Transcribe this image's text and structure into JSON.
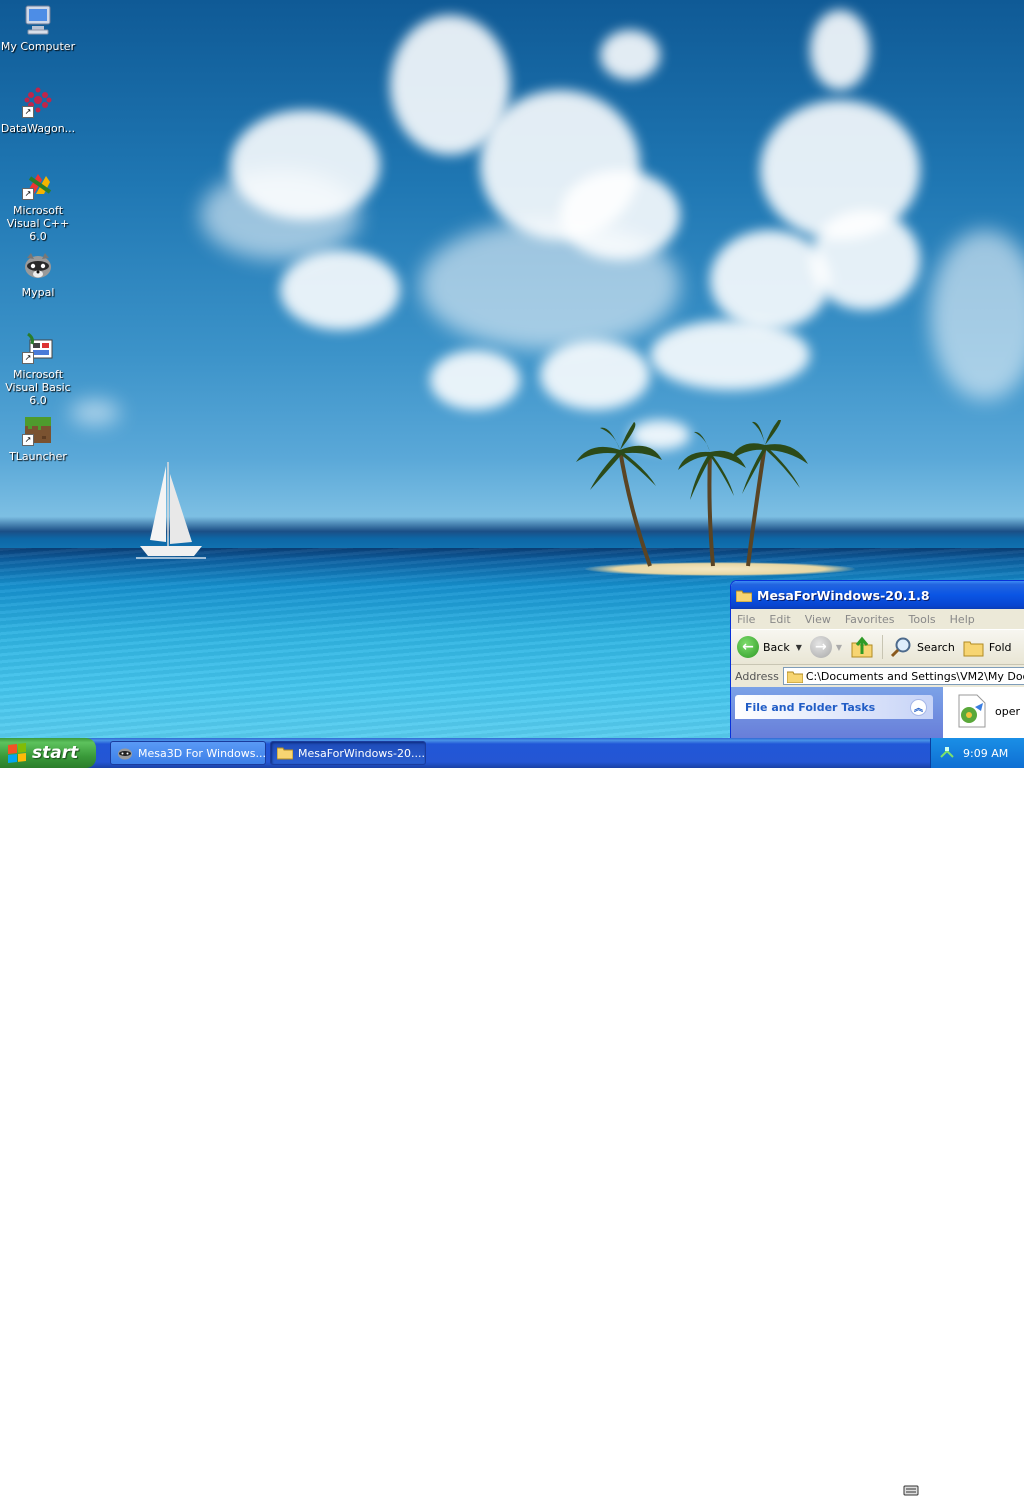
{
  "desktop": {
    "icons": [
      {
        "label": "My Computer",
        "icon": "computer-icon"
      },
      {
        "label": "DataWagon...",
        "icon": "datawagon-icon"
      },
      {
        "label": "Microsoft Visual C++ 6.0",
        "icon": "visual-cpp-icon"
      },
      {
        "label": "Mypal",
        "icon": "mypal-raccoon-icon"
      },
      {
        "label": "Microsoft Visual Basic 6.0",
        "icon": "visual-basic-icon"
      },
      {
        "label": "TLauncher",
        "icon": "tlauncher-grass-block-icon"
      }
    ]
  },
  "explorer": {
    "title": "MesaForWindows-20.1.8",
    "menu": [
      "File",
      "Edit",
      "View",
      "Favorites",
      "Tools",
      "Help"
    ],
    "toolbar": {
      "back": "Back",
      "search": "Search",
      "folders": "Fold"
    },
    "address_label": "Address",
    "address_value": "C:\\Documents and Settings\\VM2\\My Documen",
    "task_pane_title": "File and Folder Tasks",
    "file_label": "oper"
  },
  "taskbar": {
    "start_label": "start",
    "tasks": [
      {
        "label": "Mesa3D For Windows...",
        "icon": "raccoon-icon",
        "active": false
      },
      {
        "label": "MesaForWindows-20....",
        "icon": "folder-icon",
        "active": true
      }
    ],
    "clock": "9:09 AM"
  },
  "colors": {
    "title_bar": "#0a55e4",
    "start_button": "#3a9a3a",
    "taskbar": "#2456d4"
  }
}
